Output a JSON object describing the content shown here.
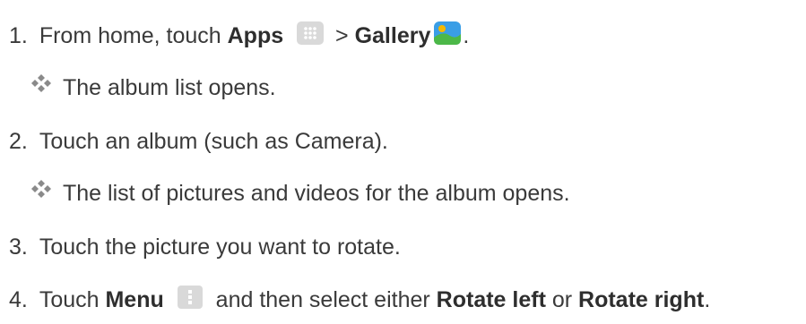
{
  "steps": [
    {
      "number": "1.",
      "pre": "From home, touch ",
      "bold1": "Apps",
      "mid": " > ",
      "bold2": "Gallery",
      "post": "."
    },
    {
      "number": "2.",
      "text": "Touch an album (such as Camera)."
    },
    {
      "number": "3.",
      "text": "Touch the picture you want to rotate."
    },
    {
      "number": "4.",
      "pre": "Touch ",
      "bold1": "Menu",
      "mid": " and then select either ",
      "bold2": "Rotate left",
      "mid2": " or ",
      "bold3": "Rotate right",
      "post": "."
    }
  ],
  "results": [
    {
      "text": "The album list opens."
    },
    {
      "text": "The list of pictures and videos for the album opens."
    }
  ],
  "icons": {
    "apps": "apps-grid-icon",
    "gallery": "gallery-icon",
    "menu": "menu-overflow-icon",
    "bullet": "diamond-bullet-icon"
  },
  "colors": {
    "text": "#3a3a3a",
    "icon_bg": "#d9d9d9",
    "gallery_sky": "#3a9ee6",
    "gallery_grass": "#4cb848",
    "gallery_sun": "#f5b800"
  }
}
